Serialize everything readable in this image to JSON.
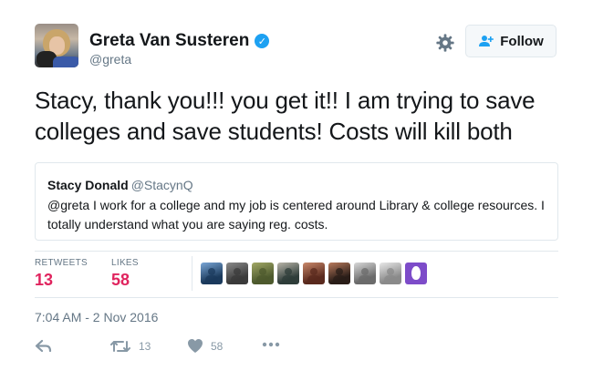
{
  "user": {
    "name": "Greta Van Susteren",
    "handle": "@greta",
    "verified_icon": "verified-badge-icon"
  },
  "follow_button": {
    "label": "Follow",
    "icon": "add-user-icon"
  },
  "settings_icon": "gear-icon",
  "tweet": {
    "text": "Stacy, thank you!!! you get it!! I am trying to save colleges and save students! Costs will kill both"
  },
  "quoted_tweet": {
    "author_name": "Stacy Donald",
    "author_handle": "@StacynQ",
    "text": "@greta  I work for a college and my job is centered around Library & college resources. I totally understand what you are saying reg. costs."
  },
  "stats": {
    "retweets_label": "RETWEETS",
    "retweets_value": "13",
    "likes_label": "LIKES",
    "likes_value": "58"
  },
  "likers": [
    {
      "name": "liker-avatar-1",
      "colors": [
        "#1b3a5c",
        "#7aa6d6"
      ]
    },
    {
      "name": "liker-avatar-2",
      "colors": [
        "#3b3b3b",
        "#8a8a8a"
      ]
    },
    {
      "name": "liker-avatar-3",
      "colors": [
        "#4d5a2e",
        "#a2a866"
      ]
    },
    {
      "name": "liker-avatar-4",
      "colors": [
        "#2f3d3a",
        "#b8b4a8"
      ]
    },
    {
      "name": "liker-avatar-5",
      "colors": [
        "#5a2a1e",
        "#c9886a"
      ]
    },
    {
      "name": "liker-avatar-6",
      "colors": [
        "#2a1d18",
        "#b97a5c"
      ]
    },
    {
      "name": "liker-avatar-7",
      "colors": [
        "#6b6b6b",
        "#d8d8d8"
      ]
    },
    {
      "name": "liker-avatar-8",
      "colors": [
        "#8a8a8a",
        "#e8e8e8"
      ]
    },
    {
      "name": "liker-avatar-9",
      "colors": [
        "#7d4cc9",
        "#ffffff"
      ]
    }
  ],
  "timestamp": "7:04 AM - 2 Nov 2016",
  "actions": {
    "reply_icon": "reply-icon",
    "retweet_icon": "retweet-icon",
    "retweet_count": "13",
    "like_icon": "heart-icon",
    "like_count": "58",
    "more_icon": "more-icon"
  },
  "colors": {
    "accent": "#1da1f2",
    "like_red": "#e0245e",
    "muted": "#657786"
  }
}
